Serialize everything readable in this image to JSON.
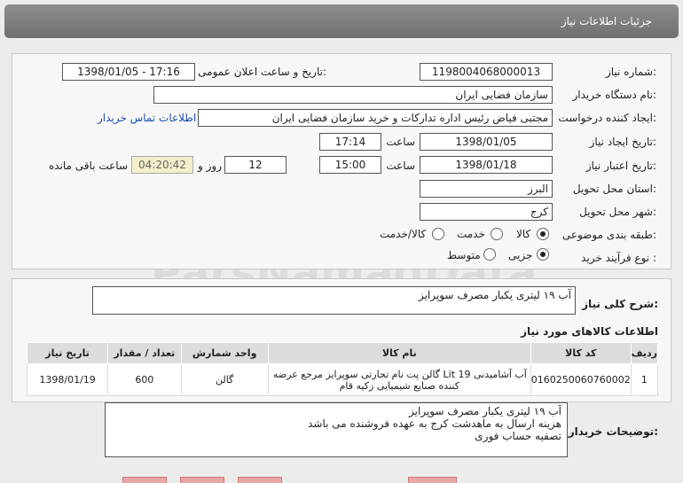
{
  "header": {
    "title": "جزئیات اطلاعات نیاز"
  },
  "form": {
    "need_number_label": "شماره نیاز:",
    "need_number": "1198004068000013",
    "announce_label": "تاریخ و ساعت اعلان عمومی:",
    "announce_value": "1398/01/05 - 17:16",
    "buyer_org_label": "نام دستگاه خریدار:",
    "buyer_org": "سازمان فضایی ایران",
    "requester_label": "ایجاد کننده درخواست:",
    "requester": "مجتبی  فیاض رئیس اداره تدارکات و خرید سازمان فضایی ایران",
    "contact_link": "اطلاعات تماس خریدار",
    "created_label": "تاریخ ایجاد نیاز:",
    "created_date": "1398/01/05",
    "time_word": "ساعت",
    "created_time": "17:14",
    "validity_label": "تاریخ اعتبار نیاز:",
    "validity_date": "1398/01/18",
    "validity_time": "15:00",
    "days": "12",
    "day_and": "روز و",
    "remaining_time": "04:20:42",
    "remaining_label": "ساعت باقی مانده",
    "province_label": "استان محل تحویل:",
    "province": "البرز",
    "city_label": "شهر محل تحویل:",
    "city": "کرج",
    "category_label": "طبقه بندی موضوعی:",
    "category_options": [
      "کالا",
      "خدمت",
      "کالا/خدمت"
    ],
    "process_label": "نوع فرآیند خرید :",
    "process_options": [
      "جزیی",
      "متوسط"
    ]
  },
  "description": {
    "label": "شرح کلی نیاز:",
    "value": "آب ۱۹ لیتری یکبار مصرف سوپرایز"
  },
  "goods": {
    "title": "اطلاعات کالاهای مورد نیاز",
    "headers": [
      "ردیف",
      "کد کالا",
      "نام کالا",
      "واحد شمارش",
      "تعداد / مقدار",
      "تاریخ نیاز"
    ],
    "rows": [
      {
        "row": "1",
        "code": "0160250060760002",
        "name_line1": "آب آشامیدنی Lit 19 گالن پت نام تجارتی سوپرایز مرجع عرضه",
        "name_line2": "کننده صنایع شیمیایی زکیه قام",
        "unit": "گالن",
        "qty": "600",
        "date": "1398/01/19"
      }
    ]
  },
  "buyer_notes": {
    "label": "توضیحات خریدار:",
    "lines": [
      "آب ۱۹ لیتری یکبار مصرف سوپرایز",
      "هزینه ارسال به ماهدشت کرج به عهده فروشنده می باشد",
      "تصفیه حساب فوری"
    ]
  }
}
